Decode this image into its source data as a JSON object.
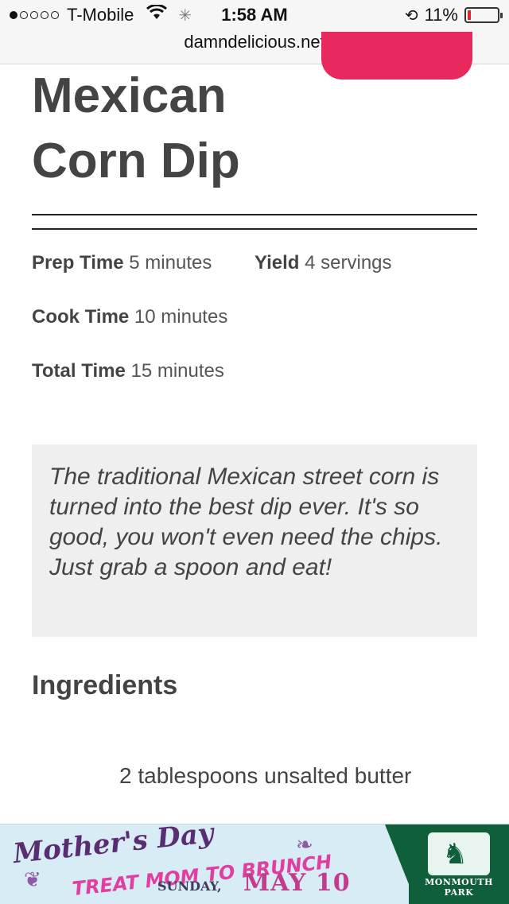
{
  "status_bar": {
    "carrier": "T-Mobile",
    "time": "1:58 AM",
    "battery_text": "11%",
    "battery_level": 0.11
  },
  "browser": {
    "url": "damndelicious.net"
  },
  "recipe": {
    "title_line1": "Mexican",
    "title_line2": "Corn Dip",
    "prep_label": "Prep Time",
    "prep_value": "5 minutes",
    "yield_label": "Yield",
    "yield_value": "4 servings",
    "cook_label": "Cook Time",
    "cook_value": "10 minutes",
    "total_label": "Total Time",
    "total_value": "15 minutes",
    "summary": "The traditional Mexican street corn is turned into the best dip ever. It's so good, you won't even need the chips. Just grab a spoon and eat!",
    "ingredients_heading": "Ingredients",
    "ingredients": [
      "2 tablespoons unsalted butter"
    ]
  },
  "ad": {
    "headline": "Mother's Day",
    "subline": "TREAT MOM TO BRUNCH",
    "day": "SUNDAY,",
    "date": "MAY 10",
    "brand": "MONMOUTH PARK"
  },
  "colors": {
    "accent": "#e8295d",
    "ad_green": "#0e5f3a",
    "ad_purple": "#5a2d73",
    "ad_pink": "#e13ea2"
  }
}
